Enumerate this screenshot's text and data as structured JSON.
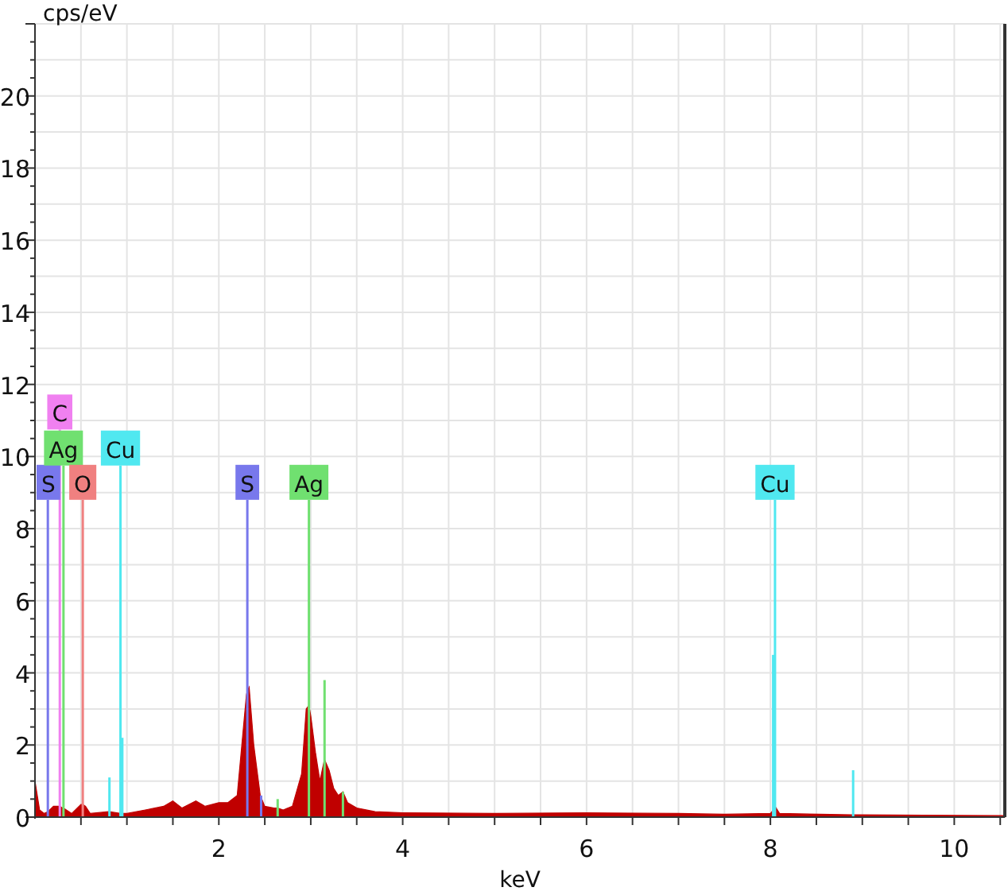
{
  "chart_data": {
    "type": "area",
    "xlabel": "keV",
    "ylabel": "cps/eV",
    "grid": true,
    "xlim": [
      0,
      10.55
    ],
    "ylim": [
      0,
      22
    ],
    "xticks": [
      2,
      4,
      6,
      8,
      10
    ],
    "yticks": [
      0,
      2,
      4,
      6,
      8,
      10,
      12,
      14,
      16,
      18,
      20
    ],
    "x": [
      0,
      0.05,
      0.1,
      0.14,
      0.2,
      0.27,
      0.3,
      0.31,
      0.4,
      0.5,
      0.52,
      0.55,
      0.6,
      0.8,
      0.81,
      0.93,
      0.95,
      1.0,
      1.2,
      1.4,
      1.5,
      1.6,
      1.75,
      1.85,
      2.0,
      2.1,
      2.2,
      2.25,
      2.3,
      2.31,
      2.33,
      2.38,
      2.45,
      2.46,
      2.5,
      2.6,
      2.64,
      2.7,
      2.8,
      2.9,
      2.95,
      2.98,
      3.0,
      3.05,
      3.1,
      3.15,
      3.2,
      3.25,
      3.3,
      3.35,
      3.4,
      3.5,
      3.7,
      4,
      5,
      6,
      7,
      7.5,
      8.0,
      8.03,
      8.05,
      8.1,
      8.9,
      9,
      10,
      10.55
    ],
    "series": [
      {
        "color": "#c00000",
        "values": [
          1.0,
          0.2,
          0.1,
          0.15,
          0.3,
          0.3,
          0.25,
          0.25,
          0.1,
          0.35,
          0.35,
          0.3,
          0.1,
          0.15,
          0.15,
          0.1,
          0.1,
          0.1,
          0.2,
          0.3,
          0.45,
          0.25,
          0.45,
          0.3,
          0.4,
          0.4,
          0.6,
          2.0,
          3.4,
          3.5,
          3.6,
          2.0,
          0.6,
          0.55,
          0.3,
          0.25,
          0.25,
          0.2,
          0.3,
          1.2,
          3.0,
          3.1,
          2.8,
          1.8,
          1.0,
          1.6,
          1.3,
          0.8,
          0.6,
          0.7,
          0.4,
          0.25,
          0.15,
          0.12,
          0.1,
          0.12,
          0.1,
          0.08,
          0.1,
          0.2,
          0.3,
          0.1,
          0.06,
          0.06,
          0.05,
          0.04
        ]
      },
      {
        "type": "bar",
        "color": "#7878ec",
        "values": [
          null,
          null,
          null,
          8.8,
          null,
          null,
          null,
          null,
          null,
          null,
          null,
          null,
          null,
          null,
          null,
          null,
          null,
          null,
          null,
          null,
          null,
          null,
          null,
          null,
          null,
          null,
          null,
          null,
          null,
          8.8,
          null,
          null,
          null,
          0.6,
          null,
          null,
          null,
          null,
          null,
          null,
          null,
          null,
          null,
          null,
          null,
          null,
          null,
          null,
          null,
          null,
          null,
          null,
          null,
          null,
          null,
          null,
          null,
          null,
          null,
          null,
          null,
          null,
          null,
          null,
          null,
          null
        ]
      },
      {
        "type": "bar",
        "color": "#f080f0",
        "values": [
          null,
          null,
          null,
          null,
          null,
          10.75,
          null,
          null,
          null,
          null,
          null,
          null,
          null,
          null,
          null,
          null,
          null,
          null,
          null,
          null,
          null,
          null,
          null,
          null,
          null,
          null,
          null,
          null,
          null,
          null,
          null,
          null,
          null,
          null,
          null,
          null,
          null,
          null,
          null,
          null,
          null,
          null,
          null,
          null,
          null,
          null,
          null,
          null,
          null,
          null,
          null,
          null,
          null,
          null,
          null,
          null,
          null,
          null,
          null,
          null,
          null,
          null,
          null,
          null,
          null,
          null
        ]
      },
      {
        "type": "bar",
        "color": "#70e070",
        "values": [
          null,
          null,
          null,
          null,
          null,
          null,
          null,
          9.75,
          null,
          null,
          null,
          null,
          null,
          null,
          null,
          null,
          null,
          null,
          null,
          null,
          null,
          null,
          null,
          null,
          null,
          null,
          null,
          null,
          null,
          null,
          null,
          null,
          null,
          null,
          null,
          null,
          0.5,
          null,
          null,
          null,
          null,
          8.8,
          null,
          null,
          null,
          3.8,
          null,
          null,
          null,
          0.7,
          null,
          null,
          null,
          null,
          null,
          null,
          null,
          null,
          null,
          null,
          null,
          null,
          null,
          null,
          null,
          null
        ]
      },
      {
        "type": "bar",
        "color": "#f08080",
        "values": [
          null,
          null,
          null,
          null,
          null,
          null,
          null,
          null,
          null,
          null,
          8.8,
          null,
          null,
          null,
          null,
          null,
          null,
          null,
          null,
          null,
          null,
          null,
          null,
          null,
          null,
          null,
          null,
          null,
          null,
          null,
          null,
          null,
          null,
          null,
          null,
          null,
          null,
          null,
          null,
          null,
          null,
          null,
          null,
          null,
          null,
          null,
          null,
          null,
          null,
          null,
          null,
          null,
          null,
          null,
          null,
          null,
          null,
          null,
          null,
          null,
          null,
          null,
          null,
          null,
          null,
          null
        ]
      },
      {
        "type": "bar",
        "color": "#50e8f0",
        "values": [
          null,
          null,
          null,
          null,
          null,
          null,
          null,
          null,
          null,
          null,
          null,
          null,
          null,
          null,
          1.1,
          9.75,
          2.2,
          null,
          null,
          null,
          null,
          null,
          null,
          null,
          null,
          null,
          null,
          null,
          null,
          null,
          null,
          null,
          null,
          null,
          null,
          null,
          null,
          null,
          null,
          null,
          null,
          null,
          null,
          null,
          null,
          null,
          null,
          null,
          null,
          null,
          null,
          null,
          null,
          null,
          null,
          null,
          null,
          null,
          null,
          4.5,
          8.8,
          null,
          1.3,
          null,
          null,
          null
        ]
      }
    ],
    "annotations": [
      {
        "text": "S",
        "x": 0.14,
        "y": 8.8
      },
      {
        "text": "C",
        "x": 0.27,
        "y": 10.75
      },
      {
        "text": "Ag",
        "x": 0.31,
        "y": 9.75
      },
      {
        "text": "O",
        "x": 0.52,
        "y": 8.8
      },
      {
        "text": "Cu",
        "x": 0.93,
        "y": 9.75
      },
      {
        "text": "S",
        "x": 2.31,
        "y": 8.8
      },
      {
        "text": "Ag",
        "x": 2.98,
        "y": 8.8
      },
      {
        "text": "Cu",
        "x": 8.05,
        "y": 8.8
      }
    ]
  }
}
